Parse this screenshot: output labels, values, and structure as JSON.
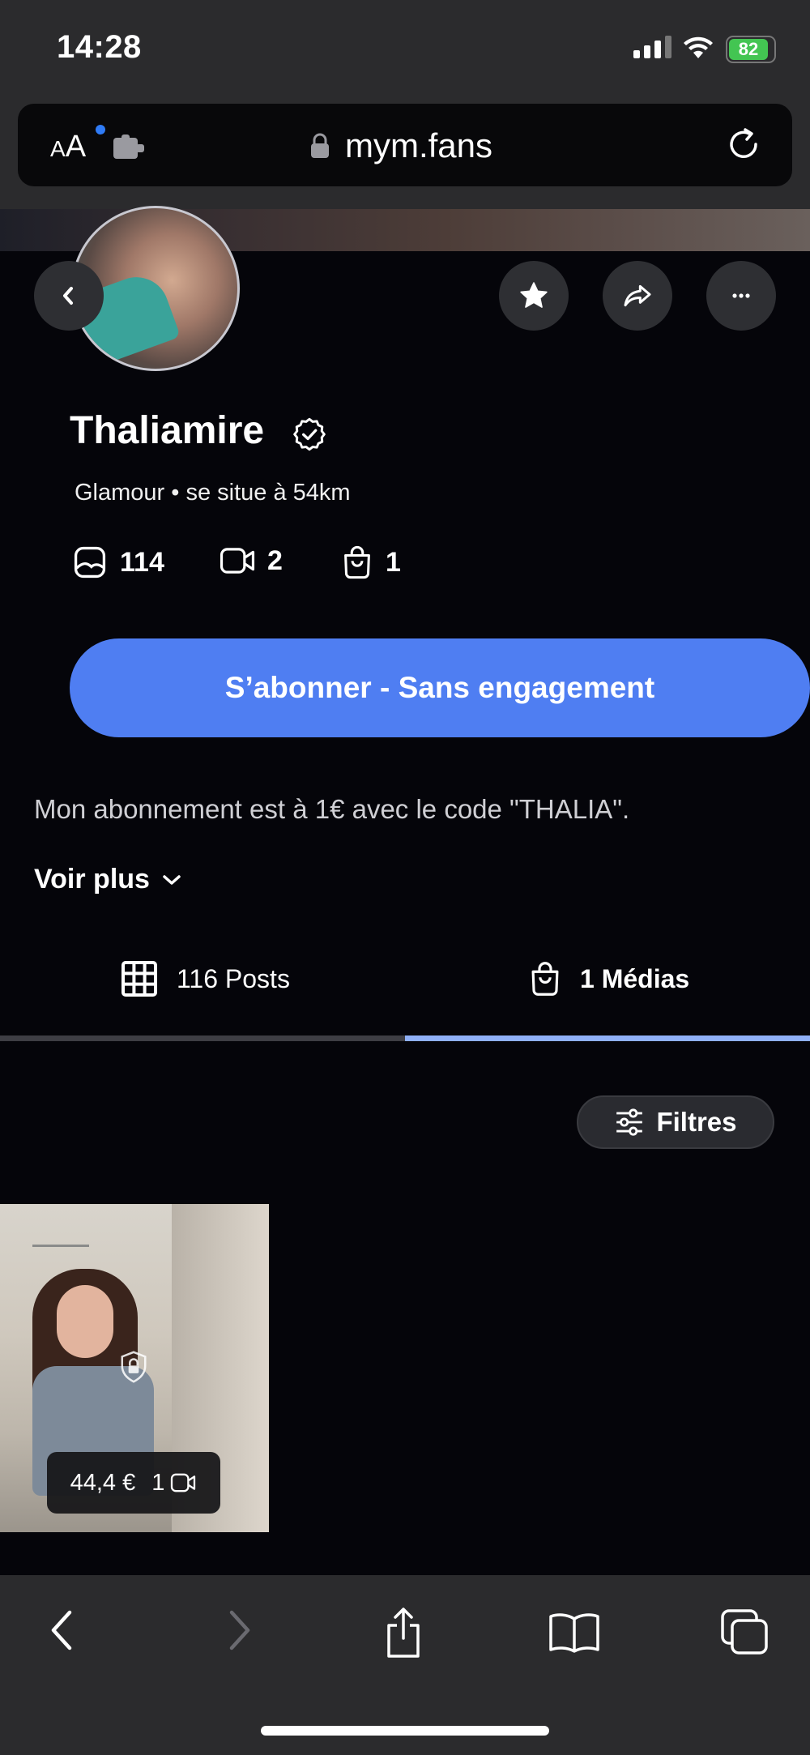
{
  "status_bar": {
    "time": "14:28",
    "battery": "82"
  },
  "browser": {
    "text_size_label": "AA",
    "url": "mym.fans"
  },
  "profile": {
    "name": "Thaliamire",
    "subtitle": "Glamour • se situe à 54km",
    "stats": {
      "photos": "114",
      "videos": "2",
      "medias": "1"
    },
    "subscribe_label": "S’abonner - Sans engagement",
    "bio": "Mon abonnement est à 1€ avec le code \"THALIA\".",
    "see_more_label": "Voir plus"
  },
  "tabs": {
    "posts_label": "116 Posts",
    "medias_label": "1 Médias"
  },
  "filter_label": "Filtres",
  "media_item": {
    "price": "44,4 €",
    "video_count": "1"
  },
  "colors": {
    "accent": "#4f7ef2",
    "background": "#05050a",
    "chrome": "#2b2b2d",
    "battery_green": "#43c552",
    "active_tab_line": "#8fb0f7"
  },
  "icons": {
    "back": "chevron-left-icon",
    "favorite": "star-icon",
    "share": "share-arrow-icon",
    "more": "more-dots-icon",
    "verified": "verified-badge-icon",
    "photos": "photo-icon",
    "videos": "video-camera-icon",
    "medias": "shopping-bag-icon",
    "posts_tab": "grid-icon",
    "filters": "sliders-icon",
    "locked": "lock-icon"
  }
}
